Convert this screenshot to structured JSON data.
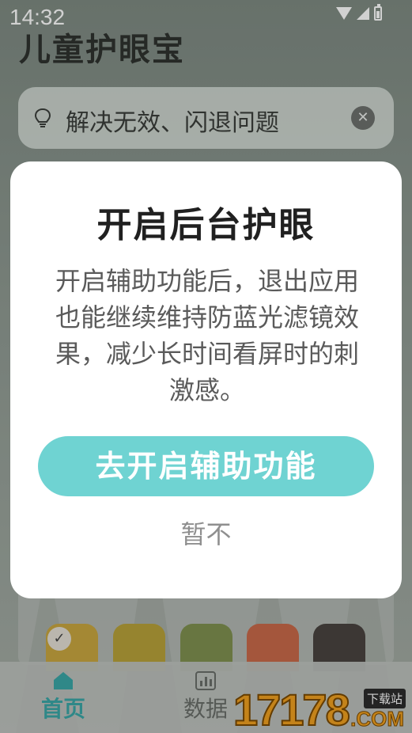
{
  "status_bar": {
    "time": "14:32"
  },
  "app": {
    "title": "儿童护眼宝"
  },
  "tip_bar": {
    "text": "解决无效、闪退问题",
    "close_symbol": "✕"
  },
  "dialog": {
    "title": "开启后台护眼",
    "body": "开启辅助功能后，退出应用也能继续维持防蓝光滤镜效果，减少长时间看屏时的刺激感。",
    "primary_button": "去开启辅助功能",
    "secondary_button": "暂不"
  },
  "swatches": {
    "selected_check": "✓",
    "colors": [
      "#c9a640",
      "#b7a23a",
      "#7f9050",
      "#c8694a",
      "#4a4440"
    ]
  },
  "bottom_nav": {
    "items": [
      {
        "label": "首页",
        "active": true
      },
      {
        "label": "数据",
        "active": false
      }
    ]
  },
  "watermark": {
    "number": "17178",
    "domain": ".COM",
    "tag": "下载站"
  },
  "colors": {
    "accent": "#6fd3d2",
    "nav_active": "#3aa6a6",
    "dialog_bg": "#ffffff"
  }
}
